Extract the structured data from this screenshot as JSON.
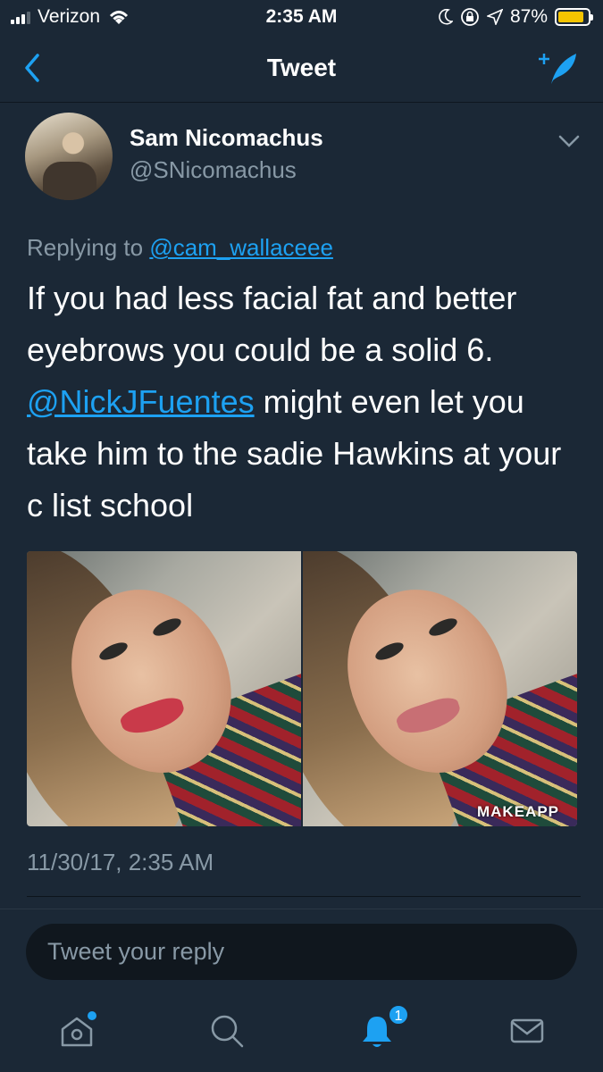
{
  "status_bar": {
    "carrier": "Verizon",
    "time": "2:35 AM",
    "battery_percent": "87%",
    "battery_level": 0.87,
    "icons": [
      "signal-icon",
      "wifi-icon",
      "moon-icon",
      "orientation-lock-icon",
      "location-icon",
      "battery-icon"
    ]
  },
  "nav": {
    "title": "Tweet",
    "back_icon": "chevron-left-icon",
    "compose_icon": "compose-tweet-icon"
  },
  "tweet": {
    "author": {
      "display_name": "Sam Nicomachus",
      "handle": "@SNicomachus"
    },
    "replying_prefix": "Replying to",
    "replying_to": "@cam_wallaceee",
    "text_part1": "If you had less facial fat and better eyebrows you could be a solid 6.",
    "mention": "@NickJFuentes",
    "text_part2": " might even let you take him to the sadie Hawkins at your c list school",
    "media_watermark": "MAKEAPP",
    "timestamp": "11/30/17, 2:35 AM"
  },
  "reply": {
    "placeholder": "Tweet your reply"
  },
  "tabbar": {
    "items": [
      {
        "name": "home",
        "icon": "home-icon",
        "has_dot": true
      },
      {
        "name": "search",
        "icon": "search-icon"
      },
      {
        "name": "notifications",
        "icon": "bell-icon",
        "badge": "1"
      },
      {
        "name": "messages",
        "icon": "mail-icon"
      }
    ]
  },
  "colors": {
    "background": "#1b2836",
    "accent": "#1da1f2",
    "secondary_text": "#8899a6",
    "battery": "#f5c400"
  }
}
